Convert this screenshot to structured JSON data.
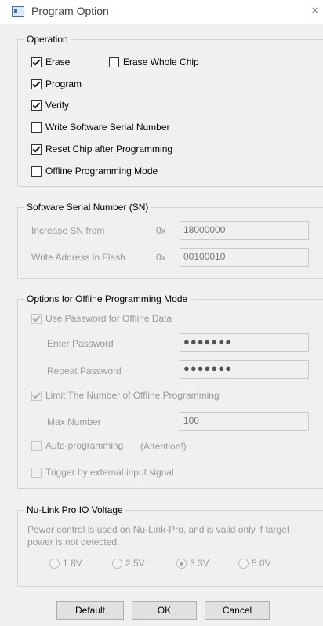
{
  "window": {
    "title": "Program Option",
    "close_glyph": "×",
    "icon": "program-option-window-icon"
  },
  "operation": {
    "label": "Operation",
    "erase": "Erase",
    "erase_whole_chip": "Erase Whole Chip",
    "program": "Program",
    "verify": "Verify",
    "write_serial": "Write Software Serial Number",
    "reset_chip": "Reset Chip after Programming",
    "offline_mode": "Offline Programming Mode"
  },
  "sn": {
    "label": "Software Serial Number (SN)",
    "increase_label": "Increase SN from",
    "prefix": "0x",
    "increase_value": "18000000",
    "address_label": "Write Address in Flash",
    "address_value": "00100010"
  },
  "offline": {
    "label": "Options for Offline Programming Mode",
    "use_password": "Use Password for Offline Data",
    "enter_password": "Enter Password",
    "password_mask": "●●●●●●●",
    "repeat_password": "Repeat Password",
    "limit": "Limit The Number of Offline Programming",
    "max_number": "Max Number",
    "max_value": "100",
    "auto_programming": "Auto-programming",
    "attention": "(Attention!)",
    "trigger": "Trigger by external input signal"
  },
  "voltage": {
    "label": "Nu-Link Pro IO Voltage",
    "note_line1": "Power control is used on Nu-Link-Pro, and is valid only if target",
    "note_line2": "power is not detected.",
    "options": [
      "1.8V",
      "2.5V",
      "3.3V",
      "5.0V"
    ],
    "selected": "3.3V"
  },
  "buttons": {
    "default": "Default",
    "ok": "OK",
    "cancel": "Cancel"
  }
}
